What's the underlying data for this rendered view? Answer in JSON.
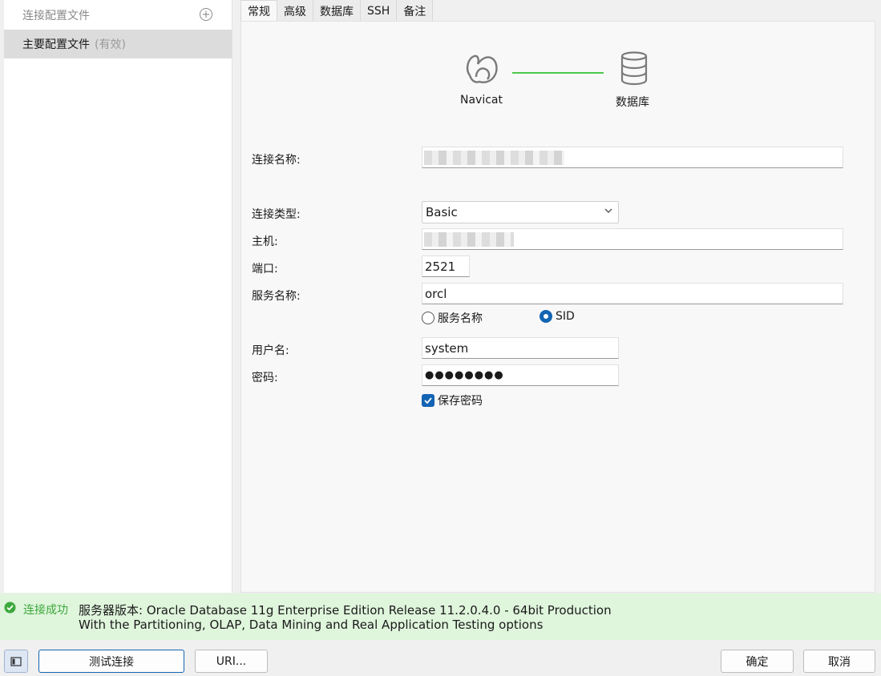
{
  "sidebar": {
    "header": "连接配置文件",
    "items": [
      {
        "label": "主要配置文件",
        "badge": "(有效)"
      }
    ]
  },
  "tabs": [
    {
      "label": "常规",
      "active": true
    },
    {
      "label": "高级"
    },
    {
      "label": "数据库"
    },
    {
      "label": "SSH"
    },
    {
      "label": "备注"
    }
  ],
  "illustration": {
    "left_label": "Navicat",
    "right_label": "数据库",
    "link_color": "#4cc84c"
  },
  "form": {
    "connection_name_label": "连接名称:",
    "connection_type_label": "连接类型:",
    "connection_type_value": "Basic",
    "host_label": "主机:",
    "port_label": "端口:",
    "port_value": "2521",
    "service_name_label": "服务名称:",
    "service_name_value": "orcl",
    "radio_service_name": "服务名称",
    "radio_sid": "SID",
    "username_label": "用户名:",
    "username_value": "system",
    "password_label": "密码:",
    "password_value": "●●●●●●●●",
    "save_password_label": "保存密码"
  },
  "status": {
    "title": "连接成功",
    "line1": "服务器版本: Oracle Database 11g Enterprise Edition Release 11.2.0.4.0 - 64bit Production",
    "line2": "With the Partitioning, OLAP, Data Mining and Real Application Testing options",
    "color": "#3ca83c"
  },
  "buttons": {
    "test": "测试连接",
    "uri": "URI...",
    "ok": "确定",
    "cancel": "取消"
  },
  "colors": {
    "accent": "#1464b4",
    "status_bg": "#dff5dc"
  }
}
